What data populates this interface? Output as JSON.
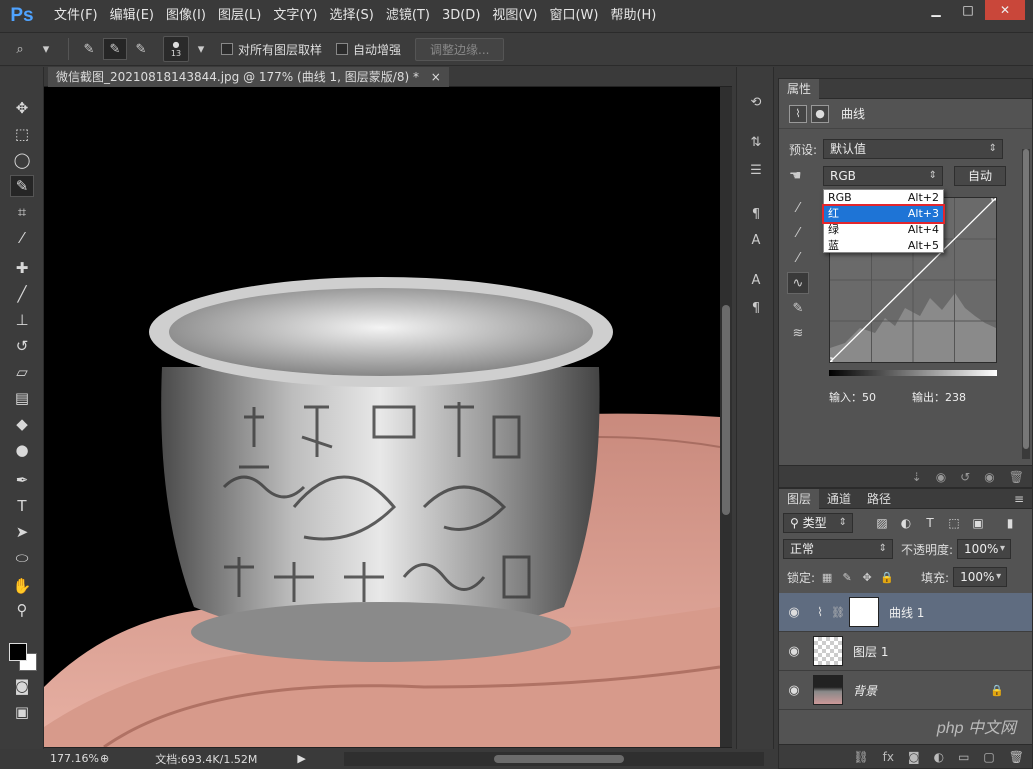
{
  "app": {
    "logo": "Ps"
  },
  "menu": [
    "文件(F)",
    "编辑(E)",
    "图像(I)",
    "图层(L)",
    "文字(Y)",
    "选择(S)",
    "滤镜(T)",
    "3D(D)",
    "视图(V)",
    "窗口(W)",
    "帮助(H)"
  ],
  "options": {
    "brush_size": "13",
    "sample_all_layers": "对所有图层取样",
    "auto_enhance": "自动增强",
    "refine_edge": "调整边缘..."
  },
  "document": {
    "tab_title": "微信截图_20210818143844.jpg @ 177% (曲线 1, 图层蒙版/8) *",
    "zoom": "177.16%",
    "doc_size": "文档:693.4K/1.52M"
  },
  "properties": {
    "tab": "属性",
    "panel_title": "曲线",
    "preset_label": "预设:",
    "preset_value": "默认值",
    "channel_value": "RGB",
    "auto_button": "自动",
    "input_label": "输入：50",
    "output_label": "输出：238"
  },
  "channel_popup": [
    {
      "label": "RGB",
      "shortcut": "Alt+2"
    },
    {
      "label": "红",
      "shortcut": "Alt+3"
    },
    {
      "label": "绿",
      "shortcut": "Alt+4"
    },
    {
      "label": "蓝",
      "shortcut": "Alt+5"
    }
  ],
  "layers_panel": {
    "tabs": [
      "图层",
      "通道",
      "路径"
    ],
    "filter_kind": "类型",
    "blend_mode": "正常",
    "opacity_label": "不透明度:",
    "opacity_value": "100%",
    "lock_label": "锁定:",
    "fill_label": "填充:",
    "fill_value": "100%",
    "layers": [
      {
        "name": "曲线 1",
        "selected": true
      },
      {
        "name": "图层 1",
        "selected": false
      },
      {
        "name": "背景",
        "selected": false
      }
    ]
  },
  "watermark": "php 中文网",
  "colors": {
    "accent": "#1e74d6",
    "highlight_box": "#e3262d",
    "ps_blue": "#4fa3ff"
  }
}
